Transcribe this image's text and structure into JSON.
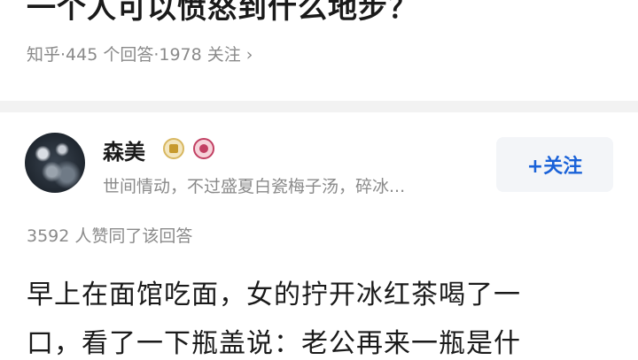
{
  "question": {
    "title": "一个人可以愤怒到什么地步？",
    "meta": "知乎·445 个回答·1978 关注",
    "meta_chevron": "›"
  },
  "author": {
    "name": "森美",
    "bio": "世间情动，不过盛夏白瓷梅子汤，碎冰...",
    "follow_label": "+关注",
    "badge_icons": [
      "gold-creator-badge-icon",
      "red-medal-badge-icon"
    ]
  },
  "answer": {
    "upvote_info": "3592 人赞同了该回答",
    "lines": [
      "早上在面馆吃面，女的拧开冰红茶喝了一",
      "口，看了一下瓶盖说：老公再来一瓶是什"
    ]
  },
  "colors": {
    "accent_blue": "#1a62d8",
    "meta_gray": "#8a8a8a",
    "divider_gray": "#f2f2f2"
  }
}
